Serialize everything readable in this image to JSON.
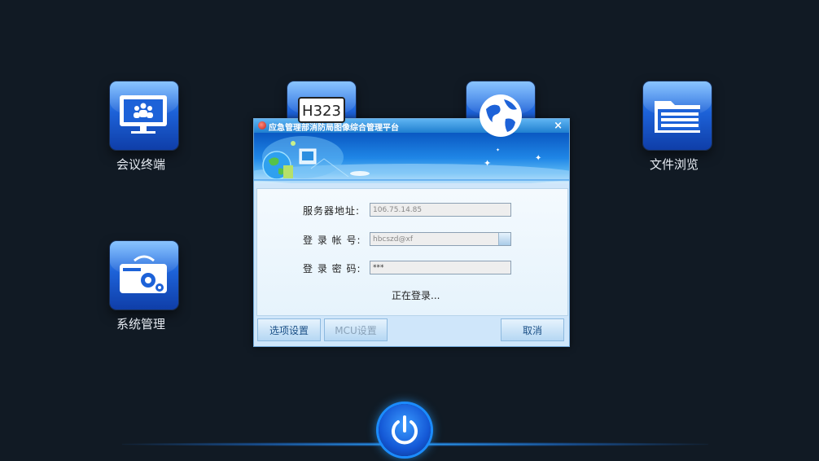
{
  "desktop": {
    "apps": [
      {
        "label": "会议终端",
        "icon": "video-conference-icon"
      },
      {
        "label": "H323",
        "icon": "h323-icon"
      },
      {
        "label": "",
        "icon": "globe-icon"
      },
      {
        "label": "文件浏览",
        "icon": "folder-icon"
      },
      {
        "label": "系统管理",
        "icon": "settings-toolbox-icon"
      }
    ],
    "power_icon": "power-icon"
  },
  "dialog": {
    "title": "应急管理部消防局图像综合管理平台",
    "close_glyph": "×",
    "server_label": "服务器地址:",
    "server_value": "106.75.14.85",
    "account_label": "登 录 帐 号:",
    "account_value": "hbcszd@xf",
    "password_label": "登 录 密 码:",
    "password_value": "***",
    "status_text": "正在登录...",
    "buttons": {
      "options": "选项设置",
      "mcu": "MCU设置",
      "cancel": "取消"
    }
  },
  "colors": {
    "background": "#111a24",
    "tile_blue": "#1d62d8",
    "accent_glow": "#2aa0ff"
  }
}
